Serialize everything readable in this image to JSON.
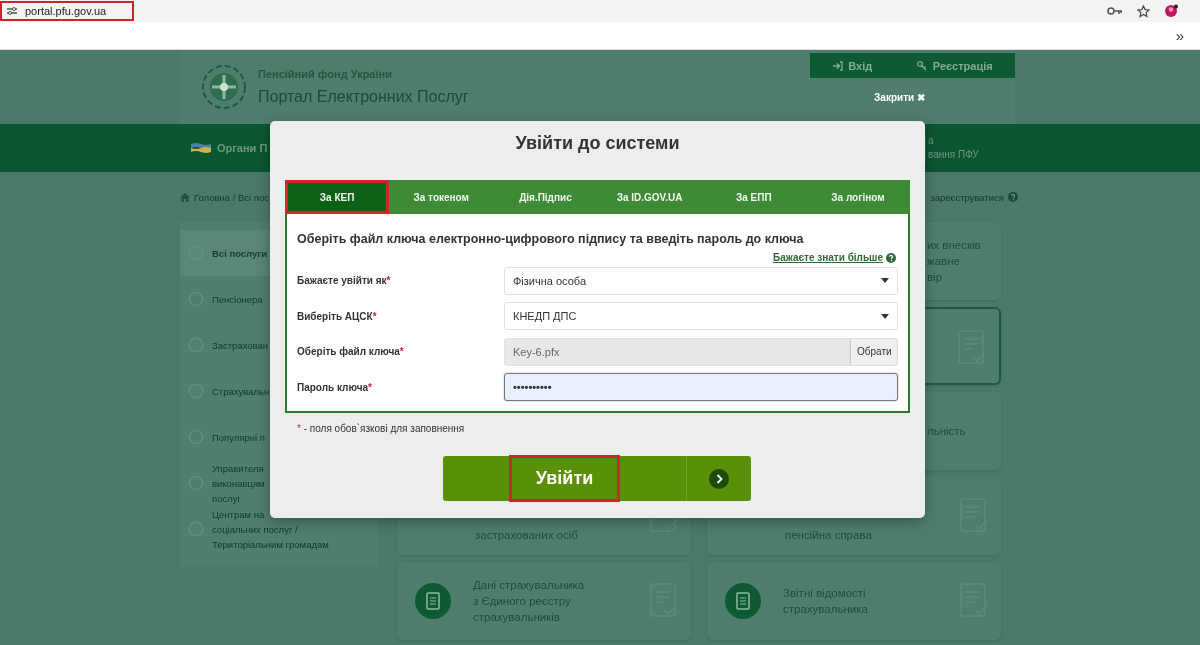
{
  "browser": {
    "url": "portal.pfu.gov.ua",
    "highlighted": true,
    "more": "»"
  },
  "header": {
    "org": "Пенсійний фонд України",
    "portal": "Портал Електронних Послуг",
    "auth": [
      {
        "label": "Вхід",
        "kind": "login"
      },
      {
        "label": "Реєстрація",
        "kind": "register"
      }
    ],
    "close": "Закрити ✖"
  },
  "nav": {
    "left": "Органи П",
    "right": [
      "а",
      "вання ПФУ"
    ]
  },
  "breadcrumb": {
    "path": "Головна / Всі пос",
    "help": "зареєструватися"
  },
  "sidebar": {
    "items": [
      {
        "lines": [
          "Всі послуги"
        ],
        "selected": true
      },
      {
        "lines": [
          "Пенсіонера"
        ],
        "selected": false
      },
      {
        "lines": [
          "Застрахован"
        ],
        "selected": false
      },
      {
        "lines": [
          "Страхувальн"
        ],
        "selected": false
      },
      {
        "lines": [
          "Популярні п"
        ],
        "selected": false
      },
      {
        "lines": [
          "Управителя",
          "виконавцям",
          "послуг"
        ],
        "selected": false
      },
      {
        "lines": [
          "Центрам на",
          "соціальних послуг /",
          "Територіальним громадам"
        ],
        "selected": false
      }
    ]
  },
  "cards": [
    {
      "kind": "peek",
      "lines": [
        "их внесків",
        "жавне",
        "вір"
      ]
    },
    {
      "kind": "outlined"
    },
    {
      "kind": "peek",
      "lines": [
        "льність"
      ]
    },
    {
      "kind": "low",
      "lines": [
        "застрахованих осіб"
      ]
    },
    {
      "kind": "low",
      "lines": [
        "пенсійна справа"
      ]
    },
    {
      "kind": "full",
      "lines": [
        "Дані страхувальника",
        "з Єдиного реєстру",
        "страхувальників"
      ]
    },
    {
      "kind": "full",
      "lines": [
        "Звітні відомості",
        "страхувальника"
      ]
    }
  ],
  "modal": {
    "title": "Увійти до системи",
    "tabs": [
      {
        "label": "За КЕП",
        "selected": true,
        "highlighted": true
      },
      {
        "label": "За токеном",
        "selected": false,
        "highlighted": false
      },
      {
        "label": "Дія.Підпис",
        "selected": false,
        "highlighted": false
      },
      {
        "label": "За ID.GOV.UA",
        "selected": false,
        "highlighted": false
      },
      {
        "label": "За ЕПП",
        "selected": false,
        "highlighted": false
      },
      {
        "label": "За логіном",
        "selected": false,
        "highlighted": false
      }
    ],
    "heading": "Оберіть файл ключа електронно-цифрового підпису та введіть пароль до ключа",
    "more_link": "Бажаєте знати більше",
    "fields": [
      {
        "kind": "select",
        "label": "Бажаєте увійти як",
        "mark": "*",
        "value": "Фізична особа",
        "focused": false
      },
      {
        "kind": "select",
        "label": "Виберіть АЦСК",
        "mark": "*",
        "value": "КНЕДП ДПС",
        "focused": false
      },
      {
        "kind": "file",
        "label": "Оберіть файл ключа",
        "mark": "*",
        "value": "Key-6.pfx",
        "button": "Обрати",
        "focused": false
      },
      {
        "kind": "password",
        "label": "Пароль ключа",
        "mark": "*",
        "value": "••••••••••",
        "focused": true
      }
    ],
    "note_mark": "*",
    "note": "- поля обов`язкові для заповнення",
    "submit": {
      "label": "Увійти",
      "highlighted": true
    }
  }
}
